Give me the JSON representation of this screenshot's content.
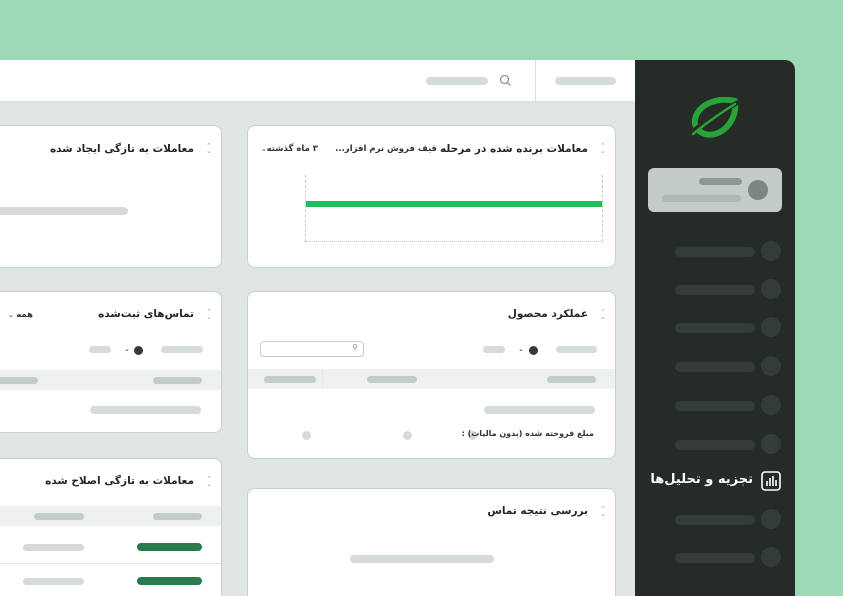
{
  "colors": {
    "page_background": "#9dd9b5",
    "sidebar": "#252b27",
    "accent_green": "#1fbf5c",
    "logo_green": "#27a339",
    "status_bar": "#2b7a4f"
  },
  "sidebar": {
    "logo_icon": "leaf-logo-icon",
    "active_item": {
      "label": "تجزیه و تحلیل‌ها",
      "icon": "bar-chart-icon"
    }
  },
  "cards": {
    "won_deals": {
      "title": "معاملات برنده شده در مرحله",
      "filter_pipeline": "قیف فروش نرم افزار...",
      "filter_period": "۳ ماه گذشته"
    },
    "recent_deals": {
      "title": "معاملات به تازگی ایجاد شده"
    },
    "product_performance": {
      "title": "عملکرد محصول",
      "metric_label": "مبلغ فروخته شده (بدون مالیات) :"
    },
    "logged_calls": {
      "title": "تماس‌های ثبت‌شده",
      "filter_all": "همه"
    },
    "call_outcome": {
      "title": "بررسی نتیجه تماس"
    },
    "modified_deals": {
      "title": "معاملات به تازگی اصلاح شده"
    }
  }
}
